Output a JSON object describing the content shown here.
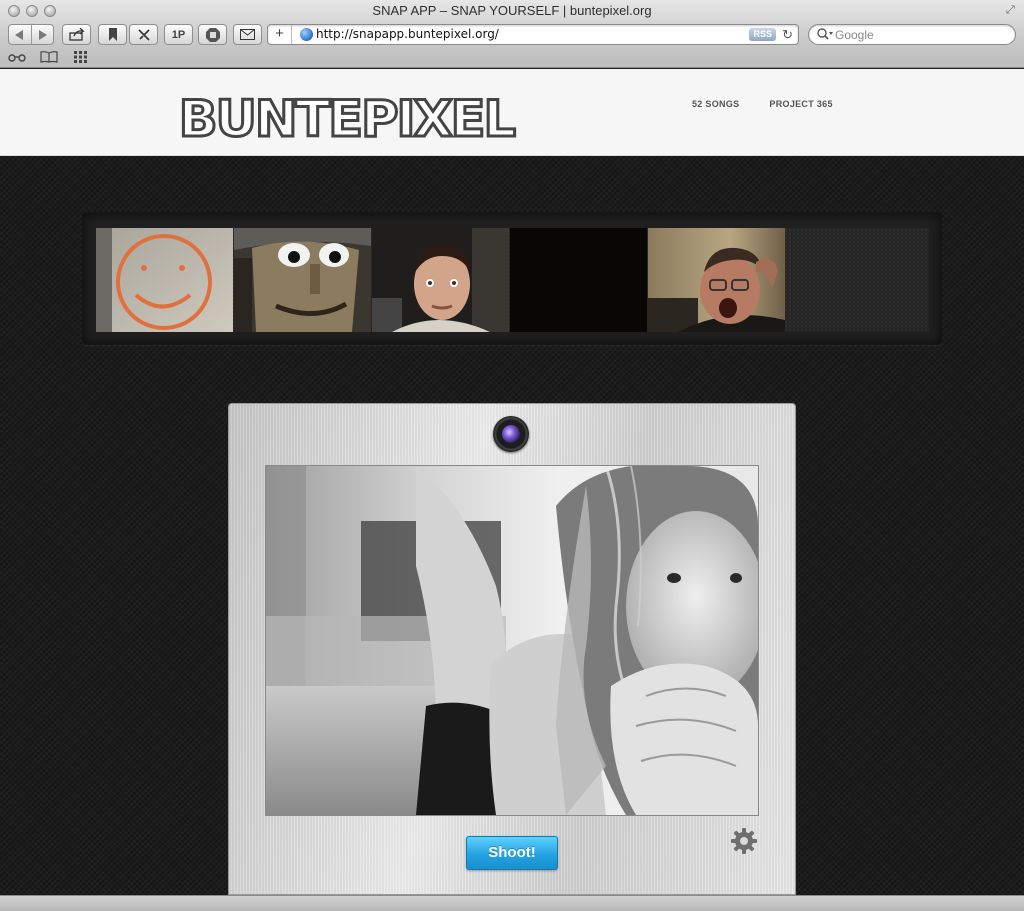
{
  "window": {
    "title": "SNAP APP – SNAP YOURSELF | buntepixel.org"
  },
  "toolbar": {
    "onepassword_label": "1P",
    "url": "http://snapapp.buntepixel.org/",
    "rss_label": "RSS",
    "search_placeholder": "Google",
    "icons": [
      "back-icon",
      "forward-icon",
      "share-icon",
      "bookmark-icon",
      "tools-icon",
      "onepassword-icon",
      "adblock-icon",
      "mail-icon",
      "reload-icon",
      "search-icon"
    ]
  },
  "bookmarks_bar": {
    "icons": [
      "reading-list-icon",
      "bookmarks-icon",
      "top-sites-icon"
    ]
  },
  "site": {
    "logo": "BUNTEPIXEL",
    "nav": [
      {
        "label": "52 SONGS"
      },
      {
        "label": "PROJECT 365"
      }
    ]
  },
  "gallery": {
    "thumbnails": [
      {
        "subject": "smiley face drawn on paper"
      },
      {
        "subject": "carved wooden face"
      },
      {
        "subject": "young man webcam selfie"
      },
      {
        "subject": "black frame"
      },
      {
        "subject": "man with glasses shouting"
      }
    ]
  },
  "camera": {
    "shoot_label": "Shoot!",
    "accent": "#24a3e2"
  }
}
